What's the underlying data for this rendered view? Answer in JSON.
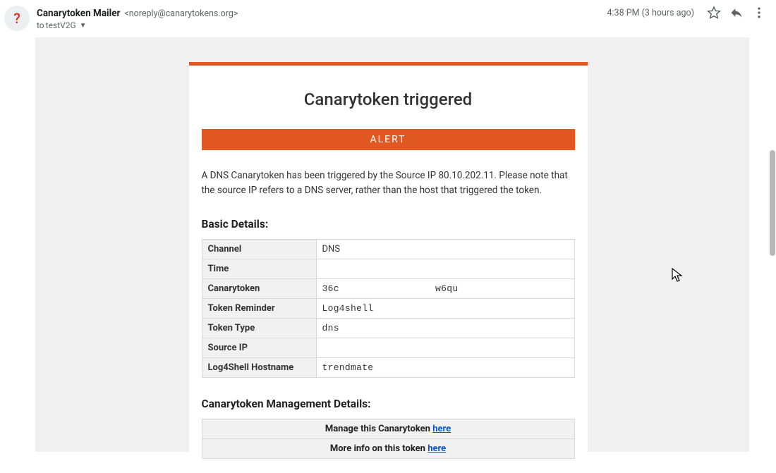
{
  "header": {
    "avatar_char": "?",
    "from_name": "Canarytoken Mailer",
    "from_addr": "<noreply@canarytokens.org>",
    "to_prefix": "to",
    "to_name": "testV2G",
    "timestamp": "4:38 PM (3 hours ago)"
  },
  "email": {
    "title": "Canarytoken triggered",
    "alert_label": "ALERT",
    "summary": "A DNS Canarytoken has been triggered by the Source IP 80.10.202.11. Please note that the source IP refers to a DNS server, rather than the host that triggered the token.",
    "basic_details_title": "Basic Details:",
    "details": {
      "channel_label": "Channel",
      "channel_value": "DNS",
      "time_label": "Time",
      "time_value": "",
      "token_label": "Canarytoken",
      "token_value_a": "36c",
      "token_value_b": "w6qu",
      "reminder_label": "Token Reminder",
      "reminder_value": "Log4shell",
      "type_label": "Token Type",
      "type_value": "dns",
      "srcip_label": "Source IP",
      "srcip_value": "",
      "l4shost_label": "Log4Shell Hostname",
      "l4shost_value": "trendmate"
    },
    "mgmt_title": "Canarytoken Management Details:",
    "mgmt_manage_prefix": "Manage this Canarytoken ",
    "mgmt_manage_link": "here",
    "mgmt_info_prefix": "More info on this token ",
    "mgmt_info_link": "here"
  }
}
